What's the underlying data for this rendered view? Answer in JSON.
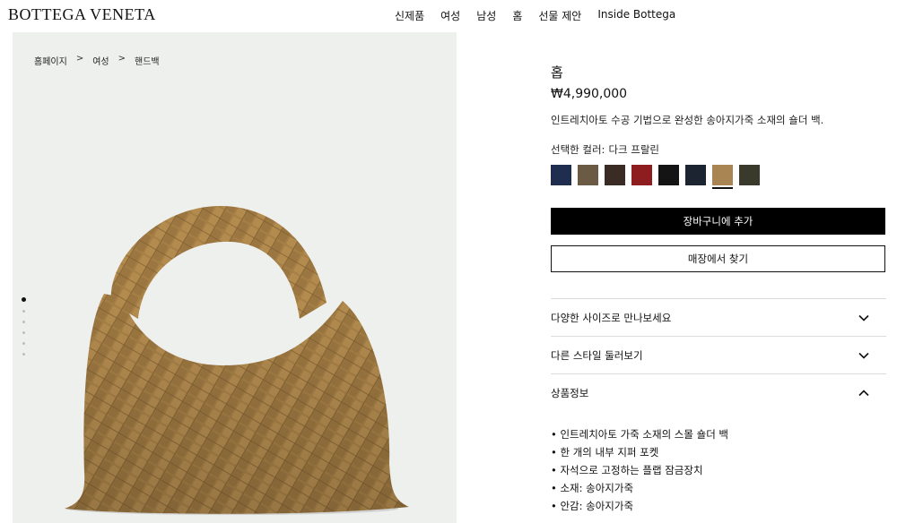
{
  "header": {
    "logo": "BOTTEGA VENETA",
    "nav": [
      "신제품",
      "여성",
      "남성",
      "홈",
      "선물 제안",
      "Inside Bottega"
    ]
  },
  "gallery": {
    "breadcrumb": [
      "홈페이지",
      "여성",
      "핸드백"
    ],
    "breadcrumb_sep": ">",
    "image_count": 6,
    "active_image_index": 0
  },
  "product": {
    "name": "홉",
    "price": "₩4,990,000",
    "description": "인트레치아토 수공 기법으로 완성한 송아지가죽 소재의 숄더 백.",
    "color_label": "선택한 컬러:",
    "color_value": "다크 프랄린",
    "swatches": [
      {
        "name": "navy",
        "color": "#1f2d4f"
      },
      {
        "name": "taupe",
        "color": "#6b5a44"
      },
      {
        "name": "dark-brown",
        "color": "#3a2c24"
      },
      {
        "name": "red",
        "color": "#8e1d1f"
      },
      {
        "name": "black",
        "color": "#141414"
      },
      {
        "name": "dark-navy",
        "color": "#1c2331"
      },
      {
        "name": "camel",
        "color": "#a98554"
      },
      {
        "name": "olive-dark",
        "color": "#3a3a2c"
      }
    ],
    "selected_swatch": 6,
    "add_to_cart": "장바구니에 추가",
    "find_in_store": "매장에서 찾기"
  },
  "accordions": [
    {
      "label": "다양한 사이즈로 만나보세요",
      "icon": "chevron-down-icon"
    },
    {
      "label": "다른 스타일 둘러보기",
      "icon": "chevron-down-icon"
    },
    {
      "label": "상품정보",
      "icon": "chevron-up-icon"
    }
  ],
  "details": [
    "인트레치아토 가죽 소재의 스몰 숄더 백",
    "한 개의 내부 지퍼 포켓",
    "자석으로 고정하는 플랩 잠금장치",
    "소재: 송아지가죽",
    "안감: 송아지가죽"
  ]
}
